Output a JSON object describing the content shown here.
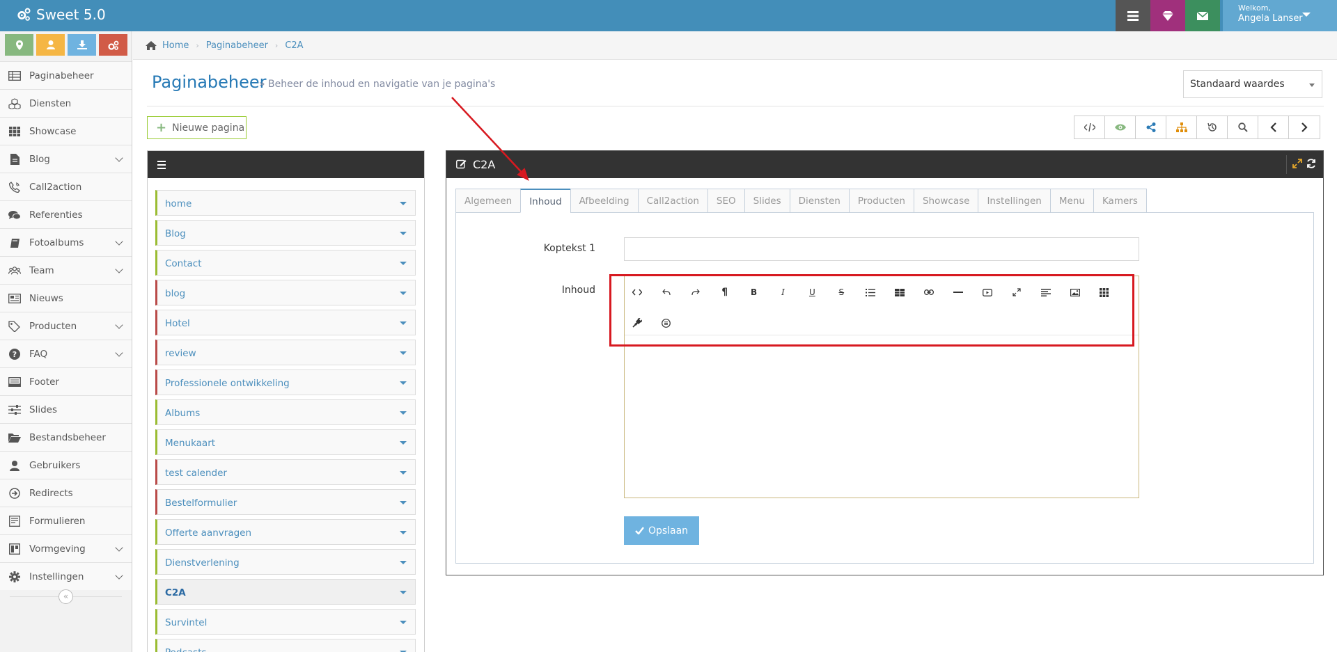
{
  "app": {
    "title": "Sweet 5.0"
  },
  "topbar": {
    "buttons": [
      {
        "icon": "tasks-icon",
        "color": "#555555"
      },
      {
        "icon": "diamond-icon",
        "color": "#a0307c"
      },
      {
        "icon": "envelope-icon",
        "color": "#3c8f5e"
      }
    ],
    "user": {
      "welcome": "Welkom,",
      "name": "Angela Lanser"
    }
  },
  "shortcuts": [
    {
      "icon": "location-icon",
      "color": "#87b87f"
    },
    {
      "icon": "user-icon",
      "color": "#f5b644"
    },
    {
      "icon": "download-icon",
      "color": "#6fb3e0"
    },
    {
      "icon": "cogs-icon",
      "color": "#d15b47"
    }
  ],
  "sidebar": {
    "items": [
      {
        "label": "Paginabeheer",
        "icon": "table-icon",
        "submenu": false
      },
      {
        "label": "Diensten",
        "icon": "cubes-icon",
        "submenu": false
      },
      {
        "label": "Showcase",
        "icon": "grid-icon",
        "submenu": false
      },
      {
        "label": "Blog",
        "icon": "file-icon",
        "submenu": true
      },
      {
        "label": "Call2action",
        "icon": "phone-volume-icon",
        "submenu": false
      },
      {
        "label": "Referenties",
        "icon": "comments-icon",
        "submenu": false
      },
      {
        "label": "Fotoalbums",
        "icon": "book-icon",
        "submenu": true
      },
      {
        "label": "Team",
        "icon": "users-icon",
        "submenu": true
      },
      {
        "label": "Nieuws",
        "icon": "newspaper-icon",
        "submenu": false
      },
      {
        "label": "Producten",
        "icon": "tags-icon",
        "submenu": true
      },
      {
        "label": "FAQ",
        "icon": "question-icon",
        "submenu": true
      },
      {
        "label": "Footer",
        "icon": "footer-icon",
        "submenu": false
      },
      {
        "label": "Slides",
        "icon": "sliders-icon",
        "submenu": false
      },
      {
        "label": "Bestandsbeheer",
        "icon": "folder-open-icon",
        "submenu": false
      },
      {
        "label": "Gebruikers",
        "icon": "user-icon",
        "submenu": false
      },
      {
        "label": "Redirects",
        "icon": "redirect-icon",
        "submenu": false
      },
      {
        "label": "Formulieren",
        "icon": "form-icon",
        "submenu": false
      },
      {
        "label": "Vormgeving",
        "icon": "layout-icon",
        "submenu": true
      },
      {
        "label": "Instellingen",
        "icon": "gear-icon",
        "submenu": true
      }
    ]
  },
  "breadcrumb": [
    "Home",
    "Paginabeheer",
    "C2A"
  ],
  "header": {
    "title": "Paginabeheer",
    "subtitle": "» Beheer de inhoud en navigatie van je pagina's",
    "select_value": "Standaard waardes",
    "new_page_label": "Nieuwe pagina"
  },
  "right_toolbar": [
    "code-icon",
    "eye-icon",
    "share-icon",
    "sitemap-icon",
    "history-icon",
    "search-icon",
    "chevron-left-icon",
    "chevron-right-icon"
  ],
  "pages": [
    {
      "label": "home",
      "status": "green",
      "active": false
    },
    {
      "label": "Blog",
      "status": "green",
      "active": false
    },
    {
      "label": "Contact",
      "status": "green",
      "active": false
    },
    {
      "label": "blog",
      "status": "red",
      "active": false
    },
    {
      "label": "Hotel",
      "status": "red",
      "active": false
    },
    {
      "label": "review",
      "status": "red",
      "active": false
    },
    {
      "label": "Professionele ontwikkeling",
      "status": "red",
      "active": false
    },
    {
      "label": "Albums",
      "status": "green",
      "active": false
    },
    {
      "label": "Menukaart",
      "status": "green",
      "active": false
    },
    {
      "label": "test calender",
      "status": "red",
      "active": false
    },
    {
      "label": "Bestelformulier",
      "status": "red",
      "active": false
    },
    {
      "label": "Offerte aanvragen",
      "status": "green",
      "active": false
    },
    {
      "label": "Dienstverlening",
      "status": "green",
      "active": false
    },
    {
      "label": "C2A",
      "status": "green",
      "active": true
    },
    {
      "label": "Survintel",
      "status": "green",
      "active": false
    },
    {
      "label": "Podcasts",
      "status": "green",
      "active": false
    }
  ],
  "editor_panel": {
    "title": "C2A",
    "tabs": [
      {
        "label": "Algemeen",
        "active": false
      },
      {
        "label": "Inhoud",
        "active": true
      },
      {
        "label": "Afbeelding",
        "active": false
      },
      {
        "label": "Call2action",
        "active": false
      },
      {
        "label": "SEO",
        "active": false
      },
      {
        "label": "Slides",
        "active": false
      },
      {
        "label": "Diensten",
        "active": false
      },
      {
        "label": "Producten",
        "active": false
      },
      {
        "label": "Showcase",
        "active": false
      },
      {
        "label": "Instellingen",
        "active": false
      },
      {
        "label": "Menu",
        "active": false
      },
      {
        "label": "Kamers",
        "active": false
      }
    ],
    "koptekst_label": "Koptekst 1",
    "koptekst_value": "",
    "inhoud_label": "Inhoud",
    "editor_tools": [
      "code-view-icon",
      "undo-icon",
      "redo-icon",
      "paragraph-icon",
      "bold-icon",
      "italic-icon",
      "underline-icon",
      "strikethrough-icon",
      "list-icon",
      "table-icon",
      "link-icon",
      "horizontal-rule-icon",
      "video-icon",
      "fullscreen-icon",
      "align-icon",
      "image-icon",
      "more-grid-icon",
      "plugin-icon",
      "special-char-icon"
    ],
    "save_label": "Opslaan"
  }
}
